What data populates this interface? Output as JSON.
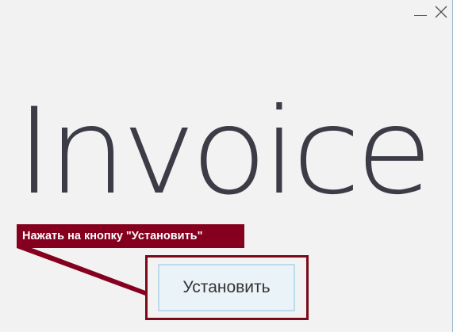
{
  "window": {
    "controls": {
      "minimize_icon": "minimize-icon",
      "close_icon": "close-icon"
    }
  },
  "logo": {
    "text": "Invoice",
    "color": "#3b3c45"
  },
  "annotation": {
    "text": "Нажать на кнопку \"Установить\"",
    "background": "#85001e"
  },
  "install_button": {
    "label": "Установить"
  }
}
